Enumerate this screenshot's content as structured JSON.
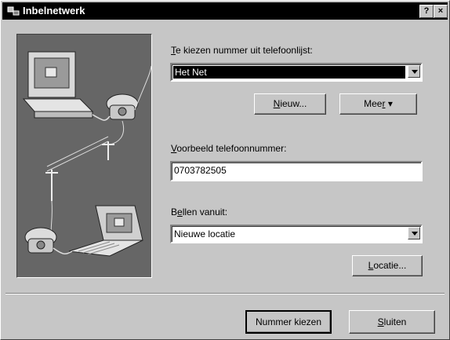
{
  "window": {
    "title": "Inbelnetwerk",
    "help_label": "?",
    "close_label": "×"
  },
  "phonebook": {
    "label_access": "T",
    "label_rest": "e kiezen nummer uit telefoonlijst:",
    "selected": "Het Net",
    "new_button_access": "N",
    "new_button_rest": "ieuw...",
    "more_button_pre": "Mee",
    "more_button_access": "r",
    "more_button_arrow": "▾"
  },
  "preview": {
    "label_access": "V",
    "label_rest": "oorbeeld telefoonnummer:",
    "value": "0703782505"
  },
  "dialing_from": {
    "label_pre": "B",
    "label_access": "e",
    "label_rest": "llen vanuit:",
    "selected": "Nieuwe locatie",
    "location_button_access": "L",
    "location_button_rest": "ocatie..."
  },
  "footer": {
    "dial_button": "Nummer kiezen",
    "close_button_access": "S",
    "close_button_rest": "luiten"
  }
}
